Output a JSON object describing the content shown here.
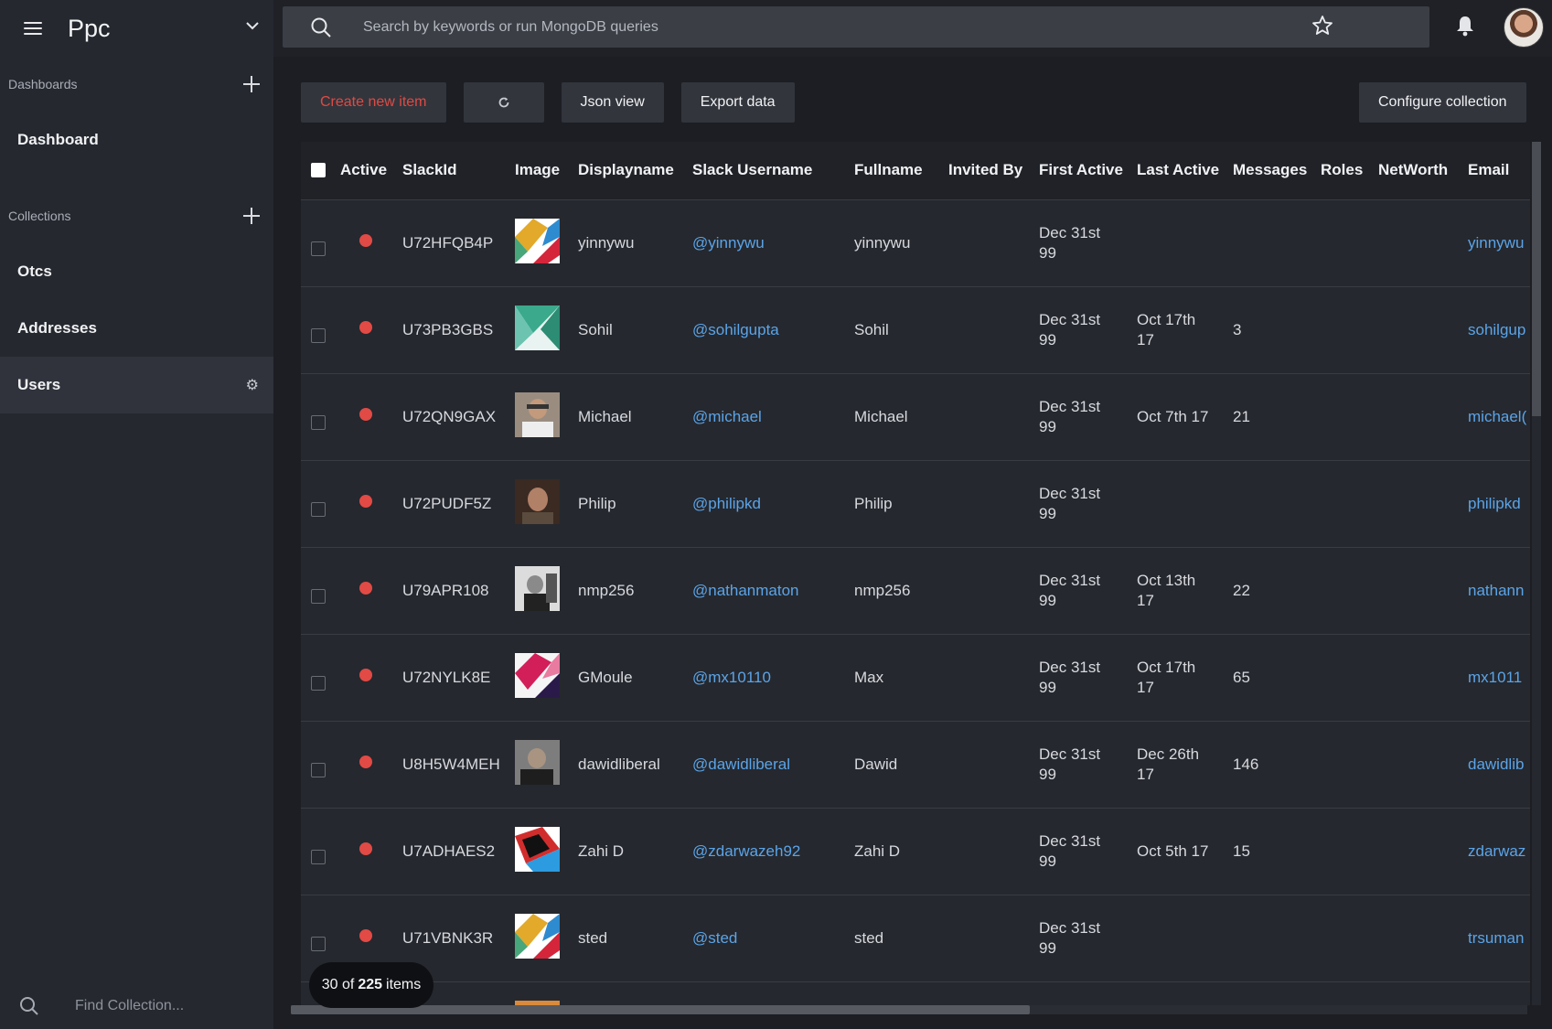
{
  "app": {
    "name": "Ppc"
  },
  "sidebar": {
    "dashboards_label": "Dashboards",
    "dashboard_item": "Dashboard",
    "collections_label": "Collections",
    "items": [
      {
        "label": "Otcs"
      },
      {
        "label": "Addresses"
      },
      {
        "label": "Users"
      }
    ],
    "find_placeholder": "Find Collection..."
  },
  "search": {
    "placeholder": "Search by keywords or run MongoDB queries"
  },
  "toolbar": {
    "create_label": "Create new item",
    "json_label": "Json view",
    "export_label": "Export data",
    "configure_label": "Configure collection"
  },
  "table": {
    "headers": [
      "Active",
      "SlackId",
      "Image",
      "Displayname",
      "Slack Username",
      "Fullname",
      "Invited By",
      "First Active",
      "Last Active",
      "Messages",
      "Roles",
      "NetWorth",
      "Email"
    ],
    "rows": [
      {
        "slackid": "U72HFQB4P",
        "display": "yinnywu",
        "username": "@yinnywu",
        "fullname": "yinnywu",
        "first1": "Dec 31st",
        "first2": "99",
        "last1": "",
        "last2": "",
        "messages": "",
        "email": "yinnywu"
      },
      {
        "slackid": "U73PB3GBS",
        "display": "Sohil",
        "username": "@sohilgupta",
        "fullname": "Sohil",
        "first1": "Dec 31st",
        "first2": "99",
        "last1": "Oct 17th",
        "last2": "17",
        "messages": "3",
        "email": "sohilgup"
      },
      {
        "slackid": "U72QN9GAX",
        "display": "Michael",
        "username": "@michael",
        "fullname": "Michael",
        "first1": "Dec 31st",
        "first2": "99",
        "last1": "Oct 7th 17",
        "last2": "",
        "messages": "21",
        "email": "michael("
      },
      {
        "slackid": "U72PUDF5Z",
        "display": "Philip",
        "username": "@philipkd",
        "fullname": "Philip",
        "first1": "Dec 31st",
        "first2": "99",
        "last1": "",
        "last2": "",
        "messages": "",
        "email": "philipkd"
      },
      {
        "slackid": "U79APR108",
        "display": "nmp256",
        "username": "@nathanmaton",
        "fullname": "nmp256",
        "first1": "Dec 31st",
        "first2": "99",
        "last1": "Oct 13th",
        "last2": "17",
        "messages": "22",
        "email": "nathann"
      },
      {
        "slackid": "U72NYLK8E",
        "display": "GMoule",
        "username": "@mx10110",
        "fullname": "Max",
        "first1": "Dec 31st",
        "first2": "99",
        "last1": "Oct 17th",
        "last2": "17",
        "messages": "65",
        "email": "mx1011"
      },
      {
        "slackid": "U8H5W4MEH",
        "display": "dawidliberal",
        "username": "@dawidliberal",
        "fullname": "Dawid",
        "first1": "Dec 31st",
        "first2": "99",
        "last1": "Dec 26th",
        "last2": "17",
        "messages": "146",
        "email": "dawidlib"
      },
      {
        "slackid": "U7ADHAES2",
        "display": "Zahi D",
        "username": "@zdarwazeh92",
        "fullname": "Zahi D",
        "first1": "Dec 31st",
        "first2": "99",
        "last1": "Oct 5th 17",
        "last2": "",
        "messages": "15",
        "email": "zdarwaz"
      },
      {
        "slackid": "U71VBNK3R",
        "display": "sted",
        "username": "@sted",
        "fullname": "sted",
        "first1": "Dec 31st",
        "first2": "99",
        "last1": "",
        "last2": "",
        "messages": "",
        "email": "trsuman"
      }
    ]
  },
  "pagination": {
    "shown": "30",
    "of": "of",
    "total": "225",
    "items": "items"
  },
  "colors": {
    "accent_red": "#e24a45",
    "link_blue": "#5ba4e8"
  }
}
